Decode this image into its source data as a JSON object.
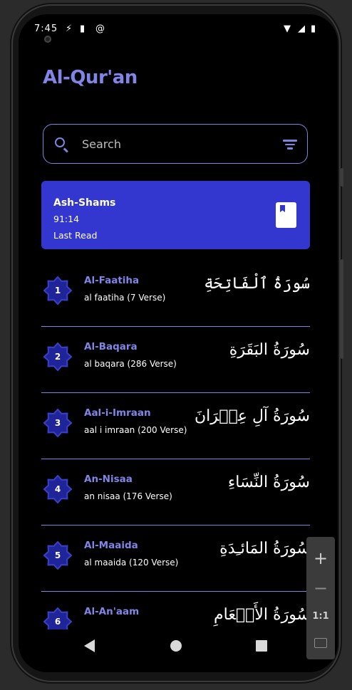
{
  "status_bar": {
    "time": "7:45",
    "icons": [
      "sync-icon",
      "sd-card-icon",
      "at-sign-icon",
      "wifi-icon",
      "signal-icon",
      "battery-icon"
    ]
  },
  "app": {
    "title": "Al-Qur'an"
  },
  "search": {
    "placeholder": "Search"
  },
  "last_read": {
    "surah": "Ash-Shams",
    "reference": "91:14",
    "label": "Last Read"
  },
  "surahs": [
    {
      "number": "1",
      "name": "Al-Faatiha",
      "subtitle": "al faatiha (7 Verse)",
      "arabic": "سُورَةُ ٱلْفَاتِحَةِ"
    },
    {
      "number": "2",
      "name": "Al-Baqara",
      "subtitle": "al baqara (286 Verse)",
      "arabic": "سُورَةُ البَقَرَةِ"
    },
    {
      "number": "3",
      "name": "Aal-i-Imraan",
      "subtitle": "aal i imraan (200 Verse)",
      "arabic": "سُورَةُ آلِ عِمۡرَانَ"
    },
    {
      "number": "4",
      "name": "An-Nisaa",
      "subtitle": "an nisaa (176 Verse)",
      "arabic": "سُورَةُ النِّسَاءِ"
    },
    {
      "number": "5",
      "name": "Al-Maaida",
      "subtitle": "al maaida (120 Verse)",
      "arabic": "سُورَةُ المَائـِدَةِ"
    },
    {
      "number": "6",
      "name": "Al-An'aam",
      "subtitle": "",
      "arabic": "سُورَةُ الأَنۡعَامِ"
    }
  ],
  "emulator_zoom": {
    "zoom_in": "+",
    "zoom_out": "−",
    "one_to_one": "1:1"
  },
  "colors": {
    "accent": "#8085e6",
    "card": "#3337d0",
    "background": "#000000"
  }
}
